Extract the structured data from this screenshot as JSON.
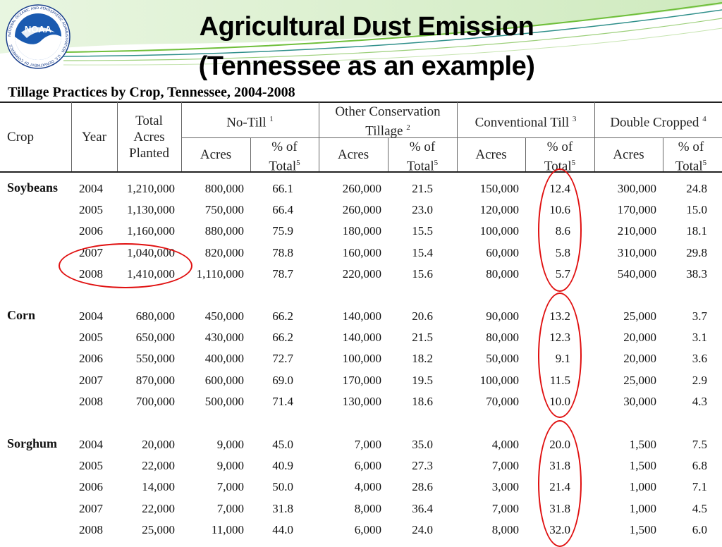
{
  "logo": {
    "text": "NOAA",
    "ring_text": "NATIONAL OCEANIC AND ATMOSPHERIC ADMINISTRATION · U.S. DEPARTMENT OF COMMERCE",
    "icon": "noaa-logo"
  },
  "slide": {
    "title_line1": "Agricultural Dust Emission",
    "title_line2": "(Tennessee as an example)"
  },
  "table": {
    "caption": "Tillage Practices by Crop, Tennessee, 2004-2008",
    "headers": {
      "crop": "Crop",
      "year": "Year",
      "total": [
        "Total",
        "Acres",
        "Planted"
      ],
      "no_till": "No-Till",
      "no_till_sup": "1",
      "other_conservation": [
        "Other Conservation",
        "Tillage"
      ],
      "other_sup": "2",
      "conventional": "Conventional Till",
      "conventional_sup": "3",
      "double_cropped": "Double Cropped",
      "double_sup": "4",
      "acres": "Acres",
      "pct": [
        "% of",
        "Total"
      ],
      "pct_sup": "5"
    },
    "groups": [
      {
        "crop": "Soybeans",
        "rows": [
          [
            "2004",
            "1,210,000",
            "800,000",
            "66.1",
            "260,000",
            "21.5",
            "150,000",
            "12.4",
            "300,000",
            "24.8"
          ],
          [
            "2005",
            "1,130,000",
            "750,000",
            "66.4",
            "260,000",
            "23.0",
            "120,000",
            "10.6",
            "170,000",
            "15.0"
          ],
          [
            "2006",
            "1,160,000",
            "880,000",
            "75.9",
            "180,000",
            "15.5",
            "100,000",
            "8.6",
            "210,000",
            "18.1"
          ],
          [
            "2007",
            "1,040,000",
            "820,000",
            "78.8",
            "160,000",
            "15.4",
            "60,000",
            "5.8",
            "310,000",
            "29.8"
          ],
          [
            "2008",
            "1,410,000",
            "1,110,000",
            "78.7",
            "220,000",
            "15.6",
            "80,000",
            "5.7",
            "540,000",
            "38.3"
          ]
        ]
      },
      {
        "crop": "Corn",
        "rows": [
          [
            "2004",
            "680,000",
            "450,000",
            "66.2",
            "140,000",
            "20.6",
            "90,000",
            "13.2",
            "25,000",
            "3.7"
          ],
          [
            "2005",
            "650,000",
            "430,000",
            "66.2",
            "140,000",
            "21.5",
            "80,000",
            "12.3",
            "20,000",
            "3.1"
          ],
          [
            "2006",
            "550,000",
            "400,000",
            "72.7",
            "100,000",
            "18.2",
            "50,000",
            "9.1",
            "20,000",
            "3.6"
          ],
          [
            "2007",
            "870,000",
            "600,000",
            "69.0",
            "170,000",
            "19.5",
            "100,000",
            "11.5",
            "25,000",
            "2.9"
          ],
          [
            "2008",
            "700,000",
            "500,000",
            "71.4",
            "130,000",
            "18.6",
            "70,000",
            "10.0",
            "30,000",
            "4.3"
          ]
        ]
      },
      {
        "crop": "Sorghum",
        "rows": [
          [
            "2004",
            "20,000",
            "9,000",
            "45.0",
            "7,000",
            "35.0",
            "4,000",
            "20.0",
            "1,500",
            "7.5"
          ],
          [
            "2005",
            "22,000",
            "9,000",
            "40.9",
            "6,000",
            "27.3",
            "7,000",
            "31.8",
            "1,500",
            "6.8"
          ],
          [
            "2006",
            "14,000",
            "7,000",
            "50.0",
            "4,000",
            "28.6",
            "3,000",
            "21.4",
            "1,000",
            "7.1"
          ],
          [
            "2007",
            "22,000",
            "7,000",
            "31.8",
            "8,000",
            "36.4",
            "7,000",
            "31.8",
            "1,000",
            "4.5"
          ],
          [
            "2008",
            "25,000",
            "11,000",
            "44.0",
            "6,000",
            "24.0",
            "8,000",
            "32.0",
            "1,500",
            "6.0"
          ]
        ]
      }
    ]
  },
  "annotation_color": "#e01010",
  "banner_colors": {
    "green": "#6fbf3a",
    "teal": "#2f8f8a",
    "light": "#cfe9c0"
  }
}
